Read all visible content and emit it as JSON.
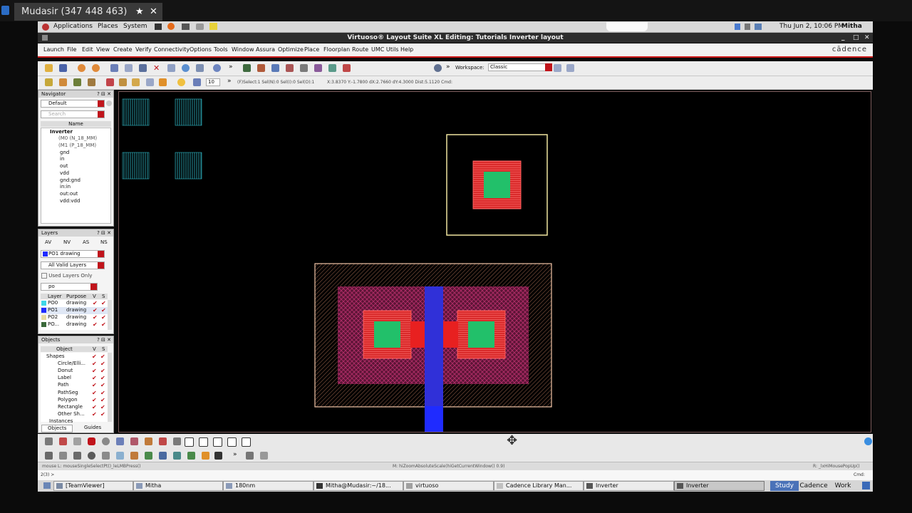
{
  "teamviewer": {
    "tab_title": "Mudasir (347 448 463)",
    "star": "★",
    "close": "✕"
  },
  "gnome": {
    "menus": [
      "Applications",
      "Places",
      "System"
    ],
    "datetime": "Thu Jun  2, 10:06 PM",
    "user": "Mitha"
  },
  "window": {
    "title": "Virtuoso® Layout Suite XL Editing: Tutorials Inverter layout",
    "brand": "cādence"
  },
  "menubar": [
    "Launch",
    "File",
    "Edit",
    "View",
    "Create",
    "Verify",
    "Connectivity",
    "Options",
    "Tools",
    "Window",
    "Assura",
    "Optimize",
    "Place",
    "Floorplan",
    "Route",
    "UMC Utils",
    "Help"
  ],
  "toolbar": {
    "workspace_label": "Workspace:",
    "workspace_value": "Classic",
    "repeat_value": "10",
    "info_text": "(F)Select:1 Sel(N):0 Sel(I):0 Sel(O):1",
    "coord_text": "X:3.8370 Y:-1.7800 dX:2.7660 dY:4.3000 Dist:5.1120 Cmd:"
  },
  "navigator": {
    "title": "Navigator",
    "filter": "Default",
    "search_placeholder": "Search",
    "col_name": "Name",
    "tree": [
      "Inverter",
      "(M0 (N_18_MM)",
      "(M1 (P_18_MM)",
      "gnd",
      "in",
      "out",
      "vdd",
      "gnd:gnd",
      "in:in",
      "out:out",
      "vdd:vdd"
    ]
  },
  "layers": {
    "title": "Layers",
    "tabs": [
      "AV",
      "NV",
      "AS",
      "NS"
    ],
    "current": "PO1 drawing",
    "filter": "All Valid Layers",
    "used_only": "Used Layers Only",
    "search": "po",
    "headers": [
      "Layer",
      "Purpose",
      "V",
      "S"
    ],
    "rows": [
      {
        "layer": "PO0",
        "purpose": "drawing",
        "color": "#3fd6e8"
      },
      {
        "layer": "PO1",
        "purpose": "drawing",
        "color": "#1f2bff"
      },
      {
        "layer": "PO2",
        "purpose": "drawing",
        "color": "#e6d8a0"
      },
      {
        "layer": "PO...",
        "purpose": "drawing",
        "color": "#3b6a3b"
      }
    ]
  },
  "objects": {
    "title": "Objects",
    "headers": [
      "Object",
      "V",
      "S"
    ],
    "rows": [
      "Shapes",
      "Circle/Elli...",
      "Donut",
      "Label",
      "Path",
      "PathSeg",
      "Polygon",
      "Rectangle",
      "Other Sh...",
      "Instances"
    ],
    "tabs": [
      "Objects",
      "Guides"
    ]
  },
  "status": {
    "left": "mouse L: mouseSingleSelectPt()_leLMBPress()",
    "middle": "M: hiZoomAbsoluteScale(hiGetCurrentWindow() 0.9)",
    "right": "R: _lxHiMousePopUp()",
    "cmd_prompt": "2(3)  >",
    "cmd_label": "Cmd:"
  },
  "taskbar": {
    "items": [
      "[TeamViewer]",
      "Mitha",
      "180nm",
      "Mitha@Mudasir:~/18...",
      "virtuoso",
      "Cadence Library Man...",
      "Inverter",
      "Inverter"
    ],
    "workspaces": [
      "Study",
      "Cadence",
      "Work"
    ]
  },
  "colors": {
    "accent_red": "#c0141b",
    "canvas": "#000000",
    "poly": "#1f2bff",
    "contact_green": "#22c06a",
    "metal_red": "#ee2a2a"
  }
}
